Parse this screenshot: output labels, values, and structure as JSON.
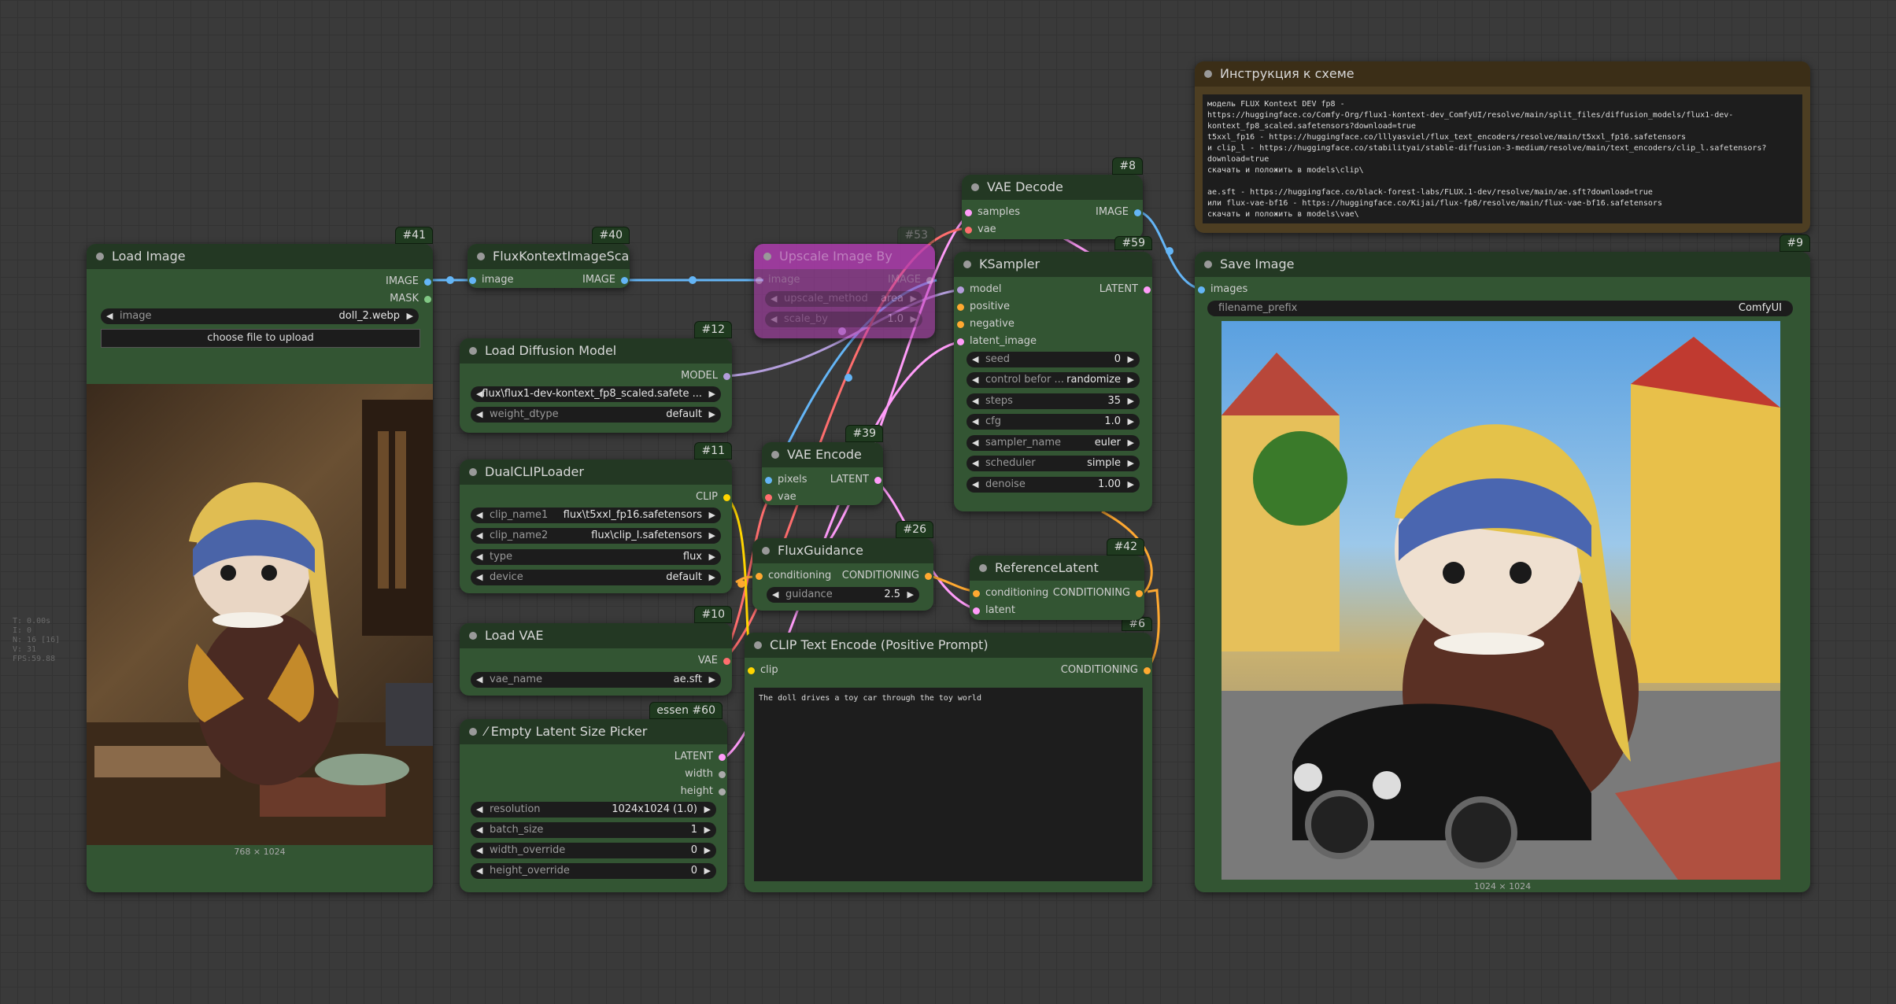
{
  "stats": [
    "T: 0.00s",
    "I: 0",
    "N: 16 [16]",
    "V: 31",
    "FPS:59.88"
  ],
  "colors": {
    "image_wire": "#64b5f6",
    "latent_wire": "#ff9cf9",
    "model_wire": "#b39ddb",
    "conditioning_wire": "#ffa931",
    "vae_wire": "#ff6e6e",
    "clip_wire": "#ffd500",
    "node_body": "#335533",
    "node_title": "#233823",
    "note_body": "#4d3e22"
  },
  "nodes": {
    "load_image": {
      "id": "#41",
      "title": "Load Image",
      "outputs": [
        "IMAGE",
        "MASK"
      ],
      "widget_image_label": "image",
      "widget_image_value": "doll_2.webp",
      "upload_button": "choose file to upload",
      "preview_caption": "768 × 1024"
    },
    "flux_scale": {
      "id": "#40",
      "title": "FluxKontextImageScale",
      "input": "image",
      "output": "IMAGE"
    },
    "upscale_bypassed": {
      "id": "#53",
      "title": "Upscale Image By",
      "input": "image",
      "output": "IMAGE",
      "w1_label": "upscale_method",
      "w1_value": "area",
      "w2_label": "scale_by",
      "w2_value": "1.0"
    },
    "load_diffusion": {
      "id": "#12",
      "title": "Load Diffusion Model",
      "output": "MODEL",
      "w1_label": "",
      "w1_value": "flux\\flux1-dev-kontext_fp8_scaled.safete ...",
      "w2_label": "weight_dtype",
      "w2_value": "default"
    },
    "dualclip": {
      "id": "#11",
      "title": "DualCLIPLoader",
      "output": "CLIP",
      "w1_label": "clip_name1",
      "w1_value": "flux\\t5xxl_fp16.safetensors",
      "w2_label": "clip_name2",
      "w2_value": "flux\\clip_l.safetensors",
      "w3_label": "type",
      "w3_value": "flux",
      "w4_label": "device",
      "w4_value": "default"
    },
    "load_vae": {
      "id": "#10",
      "title": "Load VAE",
      "output": "VAE",
      "w1_label": "vae_name",
      "w1_value": "ae.sft"
    },
    "latent_picker": {
      "id": "#60",
      "id_prefix": "essen",
      "title": "Empty Latent Size Picker",
      "outputs": [
        "LATENT",
        "width",
        "height"
      ],
      "w1_label": "resolution",
      "w1_value": "1024x1024 (1.0)",
      "w2_label": "batch_size",
      "w2_value": "1",
      "w3_label": "width_override",
      "w3_value": "0",
      "w4_label": "height_override",
      "w4_value": "0"
    },
    "vae_encode": {
      "id": "#39",
      "title": "VAE Encode",
      "inputs": [
        "pixels",
        "vae"
      ],
      "output": "LATENT"
    },
    "flux_guidance": {
      "id": "#26",
      "title": "FluxGuidance",
      "input": "conditioning",
      "output": "CONDITIONING",
      "w1_label": "guidance",
      "w1_value": "2.5"
    },
    "clip_text": {
      "id": "#6",
      "title": "CLIP Text Encode (Positive Prompt)",
      "input": "clip",
      "output": "CONDITIONING",
      "text": "The doll drives a toy car through the toy world"
    },
    "vae_decode": {
      "id": "#8",
      "title": "VAE Decode",
      "inputs": [
        "samples",
        "vae"
      ],
      "output": "IMAGE"
    },
    "ksampler": {
      "id": "#59",
      "title": "KSampler",
      "inputs": [
        "model",
        "positive",
        "negative",
        "latent_image"
      ],
      "output": "LATENT",
      "w1_label": "seed",
      "w1_value": "0",
      "w2_label": "control befor ...",
      "w2_value": "randomize",
      "w3_label": "steps",
      "w3_value": "35",
      "w4_label": "cfg",
      "w4_value": "1.0",
      "w5_label": "sampler_name",
      "w5_value": "euler",
      "w6_label": "scheduler",
      "w6_value": "simple",
      "w7_label": "denoise",
      "w7_value": "1.00"
    },
    "reference_latent": {
      "id": "#42",
      "title": "ReferenceLatent",
      "inputs": [
        "conditioning",
        "latent"
      ],
      "output": "CONDITIONING"
    },
    "note": {
      "title": "Инструкция к схеме",
      "text": "модель FLUX Kontext DEV fp8 -\nhttps://huggingface.co/Comfy-Org/flux1-kontext-dev_ComfyUI/resolve/main/split_files/diffusion_models/flux1-dev-kontext_fp8_scaled.safetensors?download=true\nt5xxl_fp16 - https://huggingface.co/lllyasviel/flux_text_encoders/resolve/main/t5xxl_fp16.safetensors\nи clip_l - https://huggingface.co/stabilityai/stable-diffusion-3-medium/resolve/main/text_encoders/clip_l.safetensors?download=true\nскачать и положить в models\\clip\\\n\nae.sft - https://huggingface.co/black-forest-labs/FLUX.1-dev/resolve/main/ae.sft?download=true\nили flux-vae-bf16 - https://huggingface.co/Kijai/flux-fp8/resolve/main/flux-vae-bf16.safetensors\nскачать и положить в models\\vae\\"
    },
    "save_image": {
      "id": "#9",
      "title": "Save Image",
      "input": "images",
      "w1_label": "filename_prefix",
      "w1_value": "ComfyUI",
      "preview_caption": "1024 × 1024"
    }
  }
}
